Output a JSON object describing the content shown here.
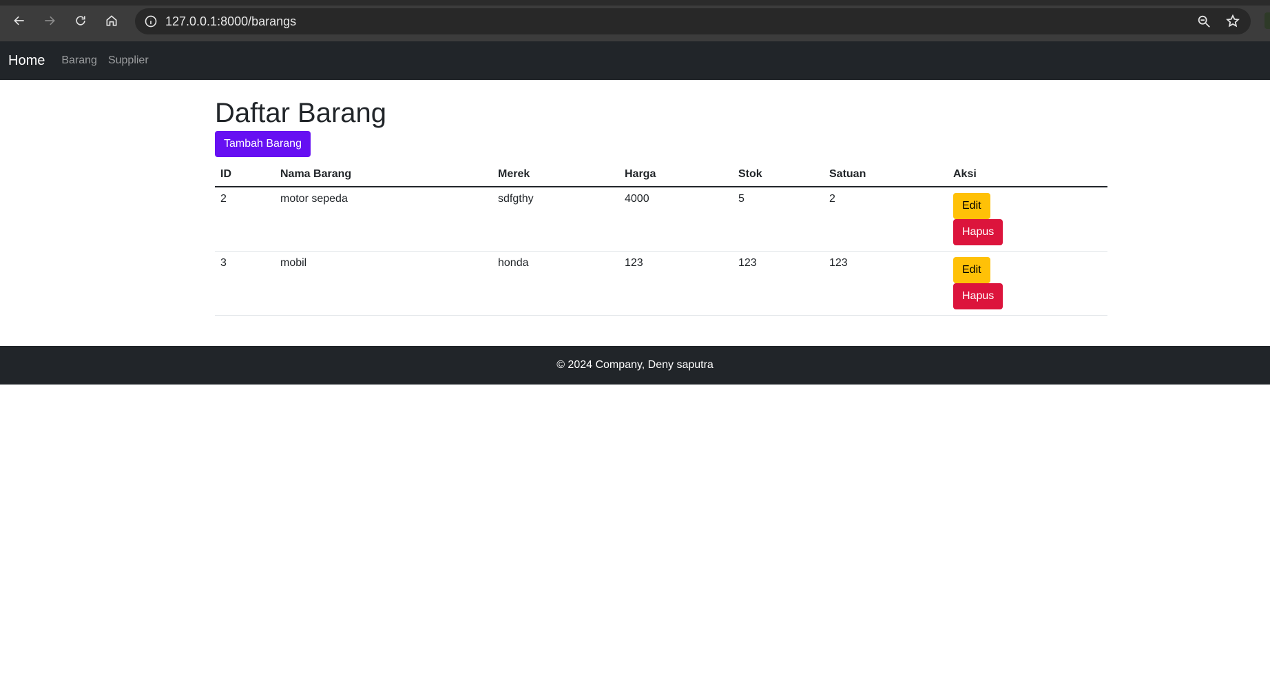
{
  "browser": {
    "url": "127.0.0.1:8000/barangs",
    "icons": [
      "back-icon",
      "forward-icon",
      "reload-icon",
      "home-icon",
      "site-info-icon",
      "zoom-icon",
      "bookmark-star-icon"
    ]
  },
  "navbar": {
    "brand": "Home",
    "links": [
      "Barang",
      "Supplier"
    ]
  },
  "main": {
    "title": "Daftar Barang",
    "add_button": "Tambah Barang",
    "table": {
      "headers": [
        "ID",
        "Nama Barang",
        "Merek",
        "Harga",
        "Stok",
        "Satuan",
        "Aksi"
      ],
      "rows": [
        {
          "id": "2",
          "nama": "motor sepeda",
          "merek": "sdfgthy",
          "harga": "4000",
          "stok": "5",
          "satuan": "2",
          "edit": "Edit",
          "hapus": "Hapus"
        },
        {
          "id": "3",
          "nama": "mobil",
          "merek": "honda",
          "harga": "123",
          "stok": "123",
          "satuan": "123",
          "edit": "Edit",
          "hapus": "Hapus"
        }
      ]
    }
  },
  "footer": {
    "text": "© 2024 Company, Deny saputra"
  },
  "colors": {
    "navbar_bg": "#212529",
    "primary": "#6610f2",
    "warning": "#ffc107",
    "danger": "#dc143c"
  }
}
